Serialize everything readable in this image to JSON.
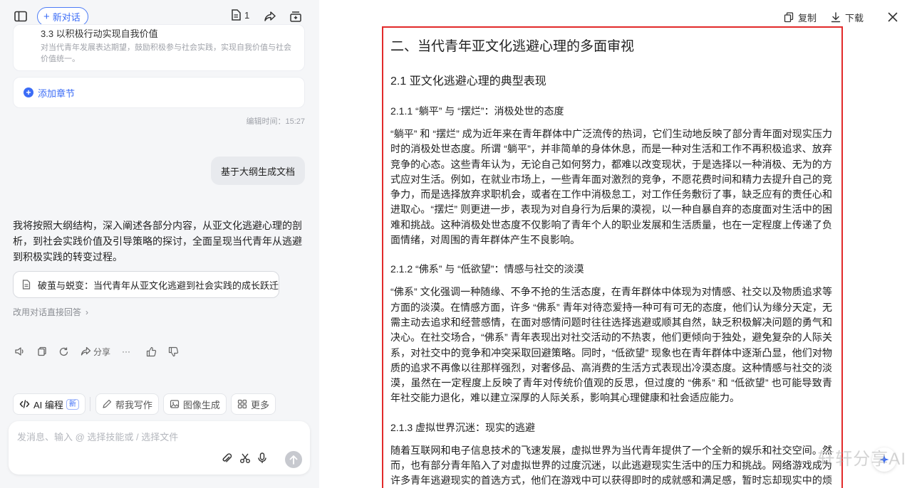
{
  "left": {
    "new_chat_label": "新对话",
    "doc_count": "1",
    "section_card": {
      "title": "3.3 以积极行动实现自我价值",
      "description": "对当代青年发展表达期望，鼓励积极参与社会实践，实现自我价值与社会价值统一。"
    },
    "add_section_label": "添加章节",
    "edit_time": "编辑时间：15:27",
    "user_message": "基于大纲生成文档",
    "answer_text": "我将按照大纲结构，深入阐述各部分内容，从亚文化逃避心理的剖析，到社会实践价值及引导策略的探讨，全面呈现当代青年从逃避到积极实践的转变过程。",
    "doc_chip_label": "破茧与蜕变：当代青年从亚文化逃避到社会实践的成长跃迁",
    "switch_link": "改用对话直接回答",
    "actions": {
      "share": "分享",
      "more": "···"
    },
    "skills": {
      "ai_coding": "AI 编程",
      "new_badge": "新",
      "writing": "帮我写作",
      "image_gen": "图像生成",
      "more": "更多"
    },
    "composer_placeholder": "发消息、输入 @ 选择技能或 / 选择文件"
  },
  "right": {
    "copy_label": "复制",
    "download_label": "下载",
    "doc": {
      "h1": "二、当代青年亚文化逃避心理的多面审视",
      "h2": "2.1 亚文化逃避心理的典型表现",
      "h3_1": "2.1.1 “躺平” 与 “摆烂”：消极处世的态度",
      "p1": "“躺平” 和 “摆烂” 成为近年来在青年群体中广泛流传的热词，它们生动地反映了部分青年面对现实压力时的消极处世态度。所谓 “躺平”，并非简单的身体休息，而是一种对生活和工作不再积极追求、放弃竞争的心态。这些青年认为，无论自己如何努力，都难以改变现状，于是选择以一种消极、无为的方式应对生活。例如，在就业市场上，一些青年面对激烈的竞争，不愿花费时间和精力去提升自己的竞争力，而是选择放弃求职机会，或者在工作中消极怠工，对工作任务敷衍了事，缺乏应有的责任心和进取心。“摆烂” 则更进一步，表现为对自身行为后果的漠视，以一种自暴自弃的态度面对生活中的困难和挑战。这种消极处世态度不仅影响了青年个人的职业发展和生活质量，也在一定程度上传递了负面情绪，对周围的青年群体产生不良影响。",
      "h3_2": "2.1.2 “佛系” 与 “低欲望”：情感与社交的淡漠",
      "p2": "“佛系” 文化强调一种随缘、不争不抢的生活态度，在青年群体中体现为对情感、社交以及物质追求等方面的淡漠。在情感方面，许多 “佛系” 青年对待恋爱持一种可有可无的态度，他们认为缘分天定，无需主动去追求和经营感情，在面对感情问题时往往选择逃避或顺其自然，缺乏积极解决问题的勇气和决心。在社交场合，“佛系” 青年表现出对社交活动的不热衷，他们更倾向于独处，避免复杂的人际关系，对社交中的竞争和冲突采取回避策略。同时，“低欲望” 现象也在青年群体中逐渐凸显，他们对物质的追求不再像以往那样强烈，对奢侈品、高消费的生活方式表现出冷漠态度。这种情感与社交的淡漠，虽然在一定程度上反映了青年对传统价值观的反思，但过度的 “佛系” 和 “低欲望” 也可能导致青年社交能力退化，难以建立深厚的人际关系，影响其心理健康和社会适应能力。",
      "h3_3": "2.1.3 虚拟世界沉迷：现实的逃避",
      "p3": "随着互联网和电子信息技术的飞速发展，虚拟世界为当代青年提供了一个全新的娱乐和社交空间。然而，也有部分青年陷入了对虚拟世界的过度沉迷，以此逃避现实生活中的压力和挑战。网络游戏成为许多青年逃避现实的首选方式，他们在游戏中可以获得即时的成就感和满足感，暂时忘却现实中的烦恼。"
    },
    "watermark": "轩轩分享AI"
  }
}
